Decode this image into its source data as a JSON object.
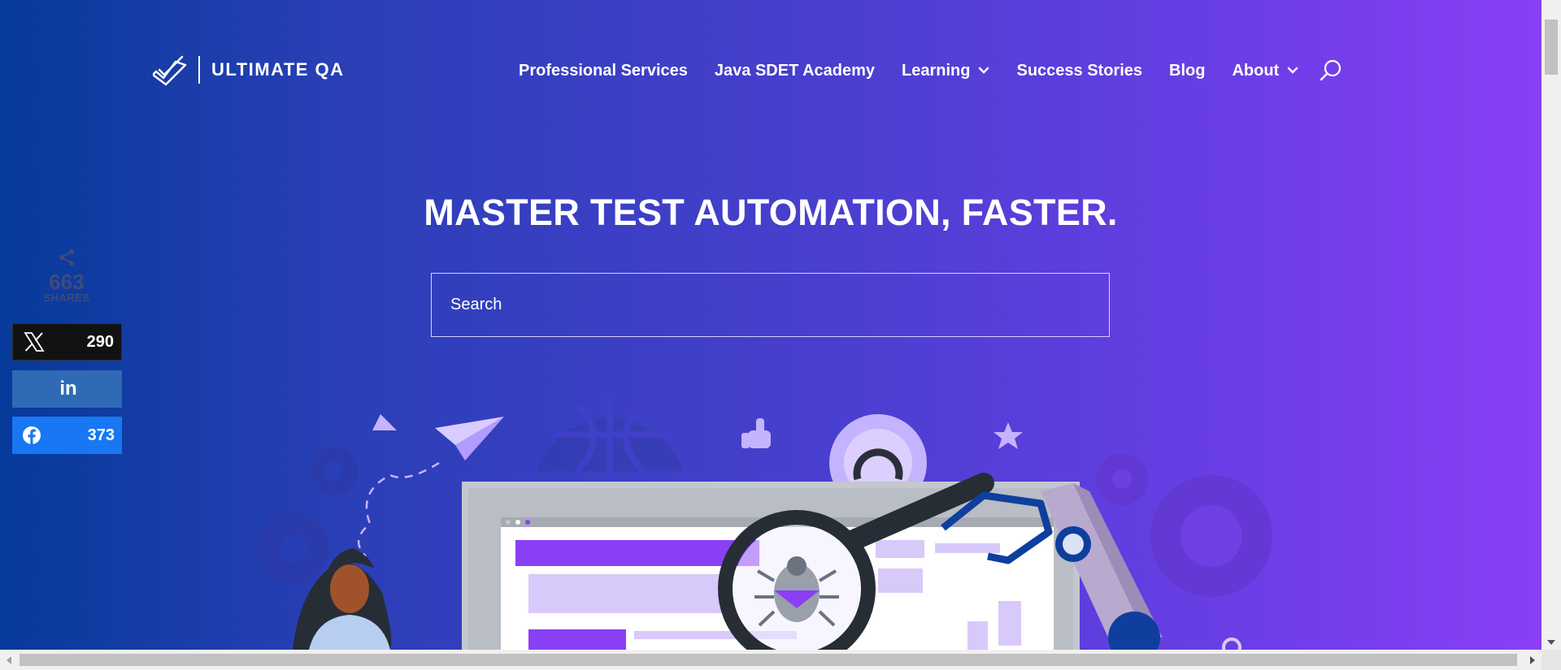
{
  "header": {
    "logo_text": "ULTIMATE QA",
    "nav": [
      {
        "label": "Professional Services",
        "has_dropdown": false
      },
      {
        "label": "Java SDET Academy",
        "has_dropdown": false
      },
      {
        "label": "Learning",
        "has_dropdown": true
      },
      {
        "label": "Success Stories",
        "has_dropdown": false
      },
      {
        "label": "Blog",
        "has_dropdown": false
      },
      {
        "label": "About",
        "has_dropdown": true
      }
    ],
    "search_icon": "search-icon"
  },
  "hero": {
    "title": "MASTER TEST AUTOMATION, FASTER.",
    "search_placeholder": "Search"
  },
  "social": {
    "total": "663",
    "total_label": "SHARES",
    "x_count": "290",
    "linkedin_label": "in",
    "facebook_count": "373"
  },
  "colors": {
    "gradient_start": "#063a9a",
    "gradient_end": "#8a3ff4",
    "x_bg": "#121212",
    "linkedin_bg": "#2f6ab4",
    "facebook_bg": "#1877f2"
  }
}
